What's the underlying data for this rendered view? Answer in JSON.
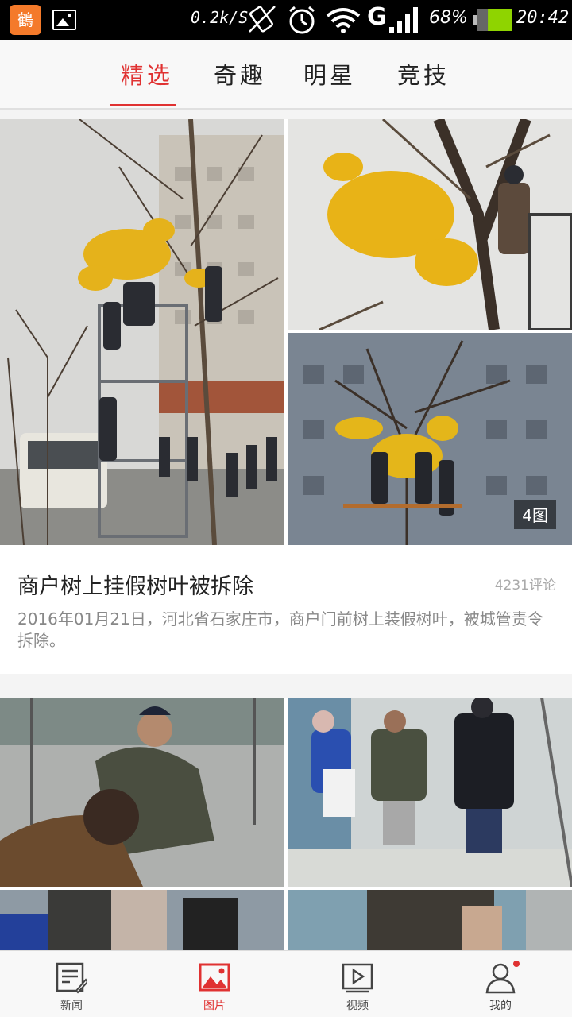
{
  "status_bar": {
    "network_speed": "0.2k/S",
    "network_type": "G",
    "battery_percent": "68%",
    "battery_level": 0.68,
    "time": "20:42",
    "icons": [
      "app-icon",
      "image-notification-icon",
      "vibrate-icon",
      "alarm-icon",
      "wifi-icon",
      "signal-icon",
      "battery-icon"
    ]
  },
  "tabs": [
    {
      "label": "精选",
      "active": true
    },
    {
      "label": "奇趣",
      "active": false
    },
    {
      "label": "明星",
      "active": false
    },
    {
      "label": "竞技",
      "active": false
    }
  ],
  "feed": {
    "card1": {
      "title": "商户树上挂假树叶被拆除",
      "comments": "4231评论",
      "description": "2016年01月21日，河北省石家庄市，商户门前树上装假树叶，被城管责令拆除。",
      "photo_count": "4图"
    }
  },
  "bottom_nav": [
    {
      "label": "新闻",
      "icon": "news-icon",
      "active": false
    },
    {
      "label": "图片",
      "icon": "picture-icon",
      "active": true
    },
    {
      "label": "视频",
      "icon": "video-icon",
      "active": false
    },
    {
      "label": "我的",
      "icon": "profile-icon",
      "active": false,
      "badge": true
    }
  ],
  "colors": {
    "accent": "#e03232",
    "status_bar_bg": "#000000",
    "battery_fill": "#8fd400"
  }
}
